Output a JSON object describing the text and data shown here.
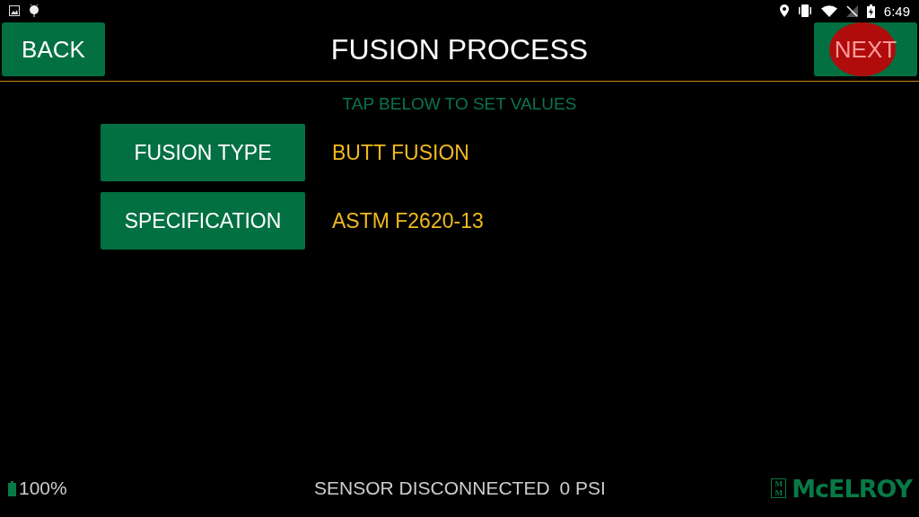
{
  "status_bar": {
    "time": "6:49"
  },
  "header": {
    "back": {
      "label": "BACK"
    },
    "title": "FUSION PROCESS",
    "next": {
      "label": "NEXT",
      "touched": true
    }
  },
  "instruction": "TAP BELOW TO SET VALUES",
  "settings": [
    {
      "label": "FUSION TYPE",
      "value": "BUTT FUSION"
    },
    {
      "label": "SPECIFICATION",
      "value": "ASTM F2620-13"
    }
  ],
  "footer": {
    "battery": "100%",
    "sensor": "SENSOR DISCONNECTED",
    "pressure": "0 PSI",
    "logo": {
      "mark": "MM",
      "name": "McELROY"
    }
  }
}
